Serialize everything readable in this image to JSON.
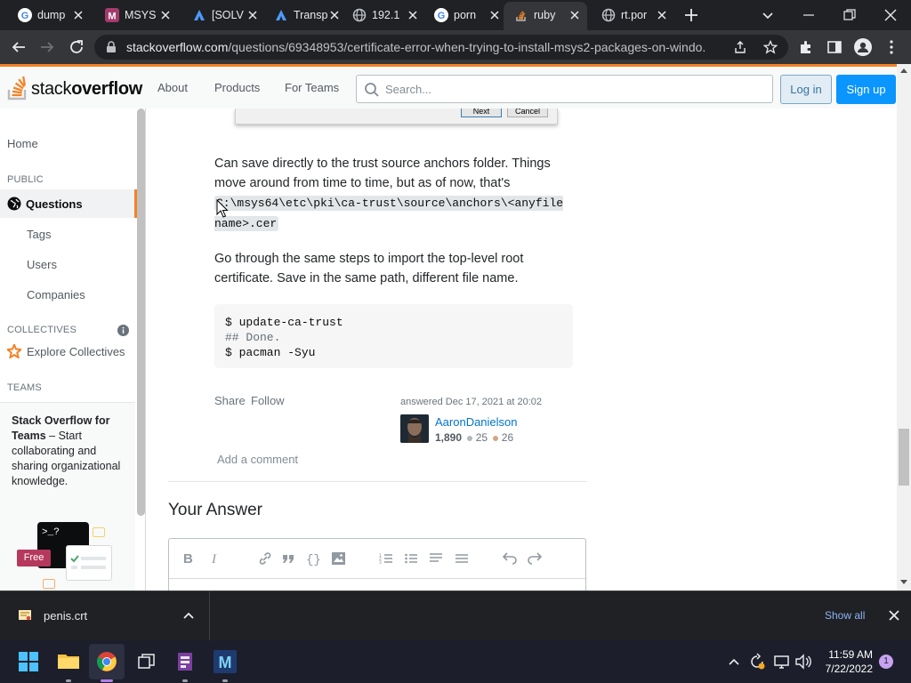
{
  "browser": {
    "tabs": [
      {
        "title": "dump",
        "icon": "google"
      },
      {
        "title": "MSYS",
        "icon": "msys"
      },
      {
        "title": "[SOLV",
        "icon": "atlassian"
      },
      {
        "title": "Transp",
        "icon": "atlassian"
      },
      {
        "title": "192.1",
        "icon": "globe"
      },
      {
        "title": "porn",
        "icon": "google"
      },
      {
        "title": "ruby",
        "icon": "stackoverflow"
      },
      {
        "title": "rt.por",
        "icon": "globe"
      }
    ],
    "active_tab_index": 6,
    "address": {
      "host": "stackoverflow.com",
      "path": "/questions/69348953/certificate-error-when-trying-to-install-msys2-packages-on-windo..."
    }
  },
  "so_header": {
    "logo_text_a": "stack",
    "logo_text_b": "overflow",
    "nav": [
      "About",
      "Products",
      "For Teams"
    ],
    "search_placeholder": "Search...",
    "login": "Log in",
    "signup": "Sign up"
  },
  "sidebar": {
    "home": "Home",
    "public_heading": "PUBLIC",
    "questions": "Questions",
    "tags": "Tags",
    "users": "Users",
    "companies": "Companies",
    "collectives_heading": "COLLECTIVES",
    "explore_collectives": "Explore Collectives",
    "teams_heading": "TEAMS",
    "teams_title": "Stack Overflow for Teams",
    "teams_dash": " – Start collaborating and sharing organizational knowledge.",
    "free_badge": "Free",
    "terminal_prompt": ">_?"
  },
  "answer": {
    "dialog_next": "Next",
    "dialog_cancel": "Cancel",
    "para1": "Can save directly to the trust source anchors folder. Things move around from time to time, but as of now, that's",
    "para1_code": "C:\\msys64\\etc\\pki\\ca-trust\\source\\anchors\\<anyfilename>.cer",
    "para2": "Go through the same steps to import the top-level root certificate. Save in the same path, different file name.",
    "code_lines": [
      "$ update-ca-trust",
      "## Done.",
      "$ pacman -Syu"
    ],
    "share": "Share",
    "follow": "Follow",
    "answered_label": "answered",
    "answered_date": "Dec 17, 2021 at 20:02",
    "user_name": "AaronDanielson",
    "reputation": "1,890",
    "silver_badges": "25",
    "bronze_badges": "26",
    "add_comment": "Add a comment",
    "your_answer": "Your Answer"
  },
  "download_bar": {
    "file_name": "penis.crt",
    "show_all": "Show all"
  },
  "taskbar": {
    "time": "11:59 AM",
    "date": "7/22/2022",
    "notification_count": "1"
  },
  "colors": {
    "so_orange": "#f48225",
    "so_blue": "#0a95ff",
    "chrome_dark": "#202124",
    "chrome_toolbar": "#35363a",
    "taskbar": "#1c1f2b"
  }
}
